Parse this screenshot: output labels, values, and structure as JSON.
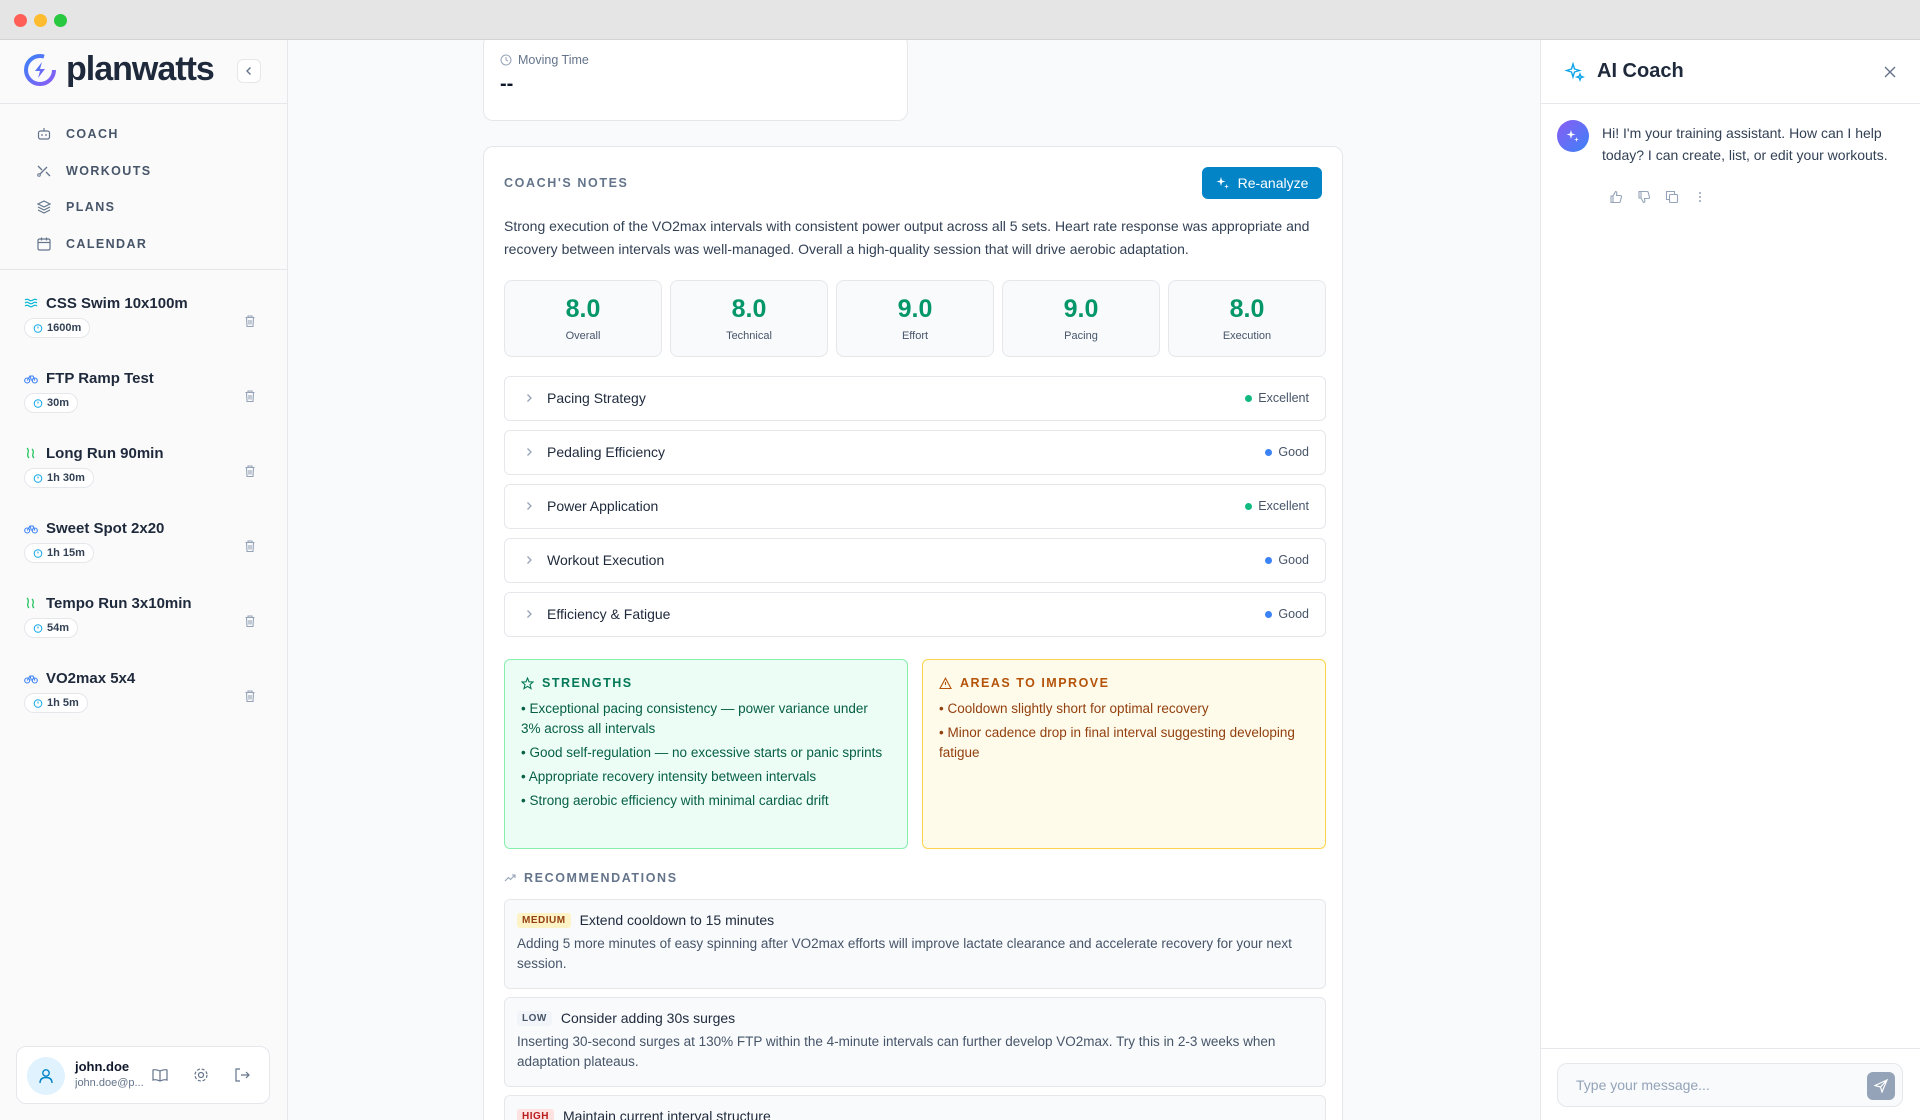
{
  "app": {
    "name": "planwatts"
  },
  "nav": [
    {
      "label": "COACH",
      "icon": "robot-icon"
    },
    {
      "label": "WORKOUTS",
      "icon": "workouts-icon"
    },
    {
      "label": "PLANS",
      "icon": "layers-icon"
    },
    {
      "label": "CALENDAR",
      "icon": "calendar-icon"
    }
  ],
  "workouts": [
    {
      "title": "CSS Swim 10x100m",
      "badge": "1600m",
      "sport": "swim-icon",
      "color": "#06b6d4"
    },
    {
      "title": "FTP Ramp Test",
      "badge": "30m",
      "sport": "bike-icon",
      "color": "#3b82f6"
    },
    {
      "title": "Long Run 90min",
      "badge": "1h 30m",
      "sport": "run-icon",
      "color": "#22c55e"
    },
    {
      "title": "Sweet Spot 2x20",
      "badge": "1h 15m",
      "sport": "bike-icon",
      "color": "#3b82f6"
    },
    {
      "title": "Tempo Run 3x10min",
      "badge": "54m",
      "sport": "run-icon",
      "color": "#22c55e"
    },
    {
      "title": "VO2max 5x4",
      "badge": "1h 5m",
      "sport": "bike-icon",
      "color": "#3b82f6"
    }
  ],
  "user": {
    "name": "john.doe",
    "email": "john.doe@p..."
  },
  "moving_time": {
    "label": "Moving Time",
    "value": "--"
  },
  "coach_notes": {
    "title": "COACH'S NOTES",
    "reanalyze_label": "Re-analyze",
    "summary": "Strong execution of the VO2max intervals with consistent power output across all 5 sets. Heart rate response was appropriate and recovery between intervals was well-managed. Overall a high-quality session that will drive aerobic adaptation.",
    "scores": [
      {
        "value": "8.0",
        "label": "Overall"
      },
      {
        "value": "8.0",
        "label": "Technical"
      },
      {
        "value": "9.0",
        "label": "Effort"
      },
      {
        "value": "9.0",
        "label": "Pacing"
      },
      {
        "value": "8.0",
        "label": "Execution"
      }
    ],
    "sections": [
      {
        "title": "Pacing Strategy",
        "status": "Excellent",
        "color": "#10b981"
      },
      {
        "title": "Pedaling Efficiency",
        "status": "Good",
        "color": "#3b82f6"
      },
      {
        "title": "Power Application",
        "status": "Excellent",
        "color": "#10b981"
      },
      {
        "title": "Workout Execution",
        "status": "Good",
        "color": "#3b82f6"
      },
      {
        "title": "Efficiency & Fatigue",
        "status": "Good",
        "color": "#3b82f6"
      }
    ],
    "strengths": {
      "title": "STRENGTHS",
      "items": [
        "• Exceptional pacing consistency — power variance under 3% across all intervals",
        "• Good self-regulation — no excessive starts or panic sprints",
        "• Appropriate recovery intensity between intervals",
        "• Strong aerobic efficiency with minimal cardiac drift"
      ]
    },
    "improve": {
      "title": "AREAS TO IMPROVE",
      "items": [
        "• Cooldown slightly short for optimal recovery",
        "• Minor cadence drop in final interval suggesting developing fatigue"
      ]
    },
    "recommendations_title": "RECOMMENDATIONS",
    "recommendations": [
      {
        "priority": "MEDIUM",
        "level": "medium",
        "title": "Extend cooldown to 15 minutes",
        "desc": "Adding 5 more minutes of easy spinning after VO2max efforts will improve lactate clearance and accelerate recovery for your next session."
      },
      {
        "priority": "LOW",
        "level": "low",
        "title": "Consider adding 30s surges",
        "desc": "Inserting 30-second surges at 130% FTP within the 4-minute intervals can further develop VO2max. Try this in 2-3 weeks when adaptation plateaus."
      },
      {
        "priority": "HIGH",
        "level": "high",
        "title": "Maintain current interval structure",
        "desc": ""
      }
    ]
  },
  "ai_coach": {
    "title": "AI Coach",
    "greeting": "Hi! I'm your training assistant. How can I help today? I can create, list, or edit your workouts.",
    "input_placeholder": "Type your message..."
  }
}
